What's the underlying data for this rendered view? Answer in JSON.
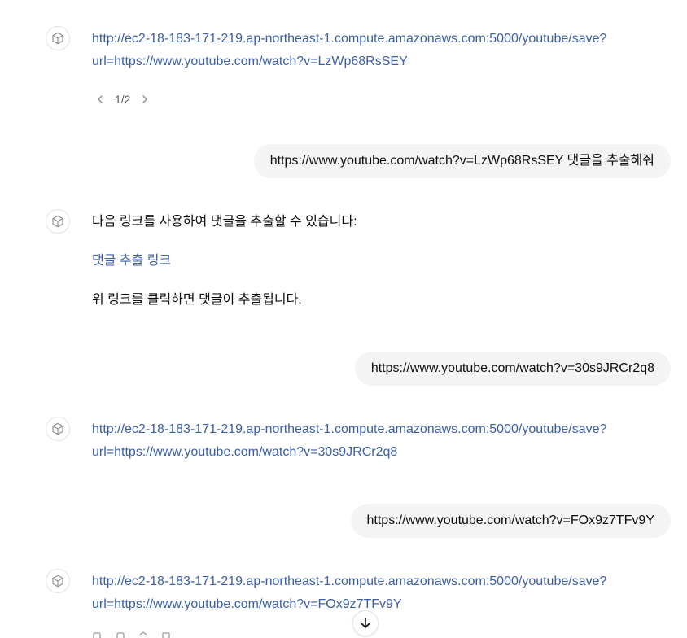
{
  "messages": [
    {
      "role": "assistant",
      "link_line1": "http://ec2-18-183-171-219.ap-northeast-1.compute.amazonaws.com:5000/youtube/save?",
      "link_line2": "url=https://www.youtube.com/watch?v=LzWp68RsSEY",
      "pager": "1/2"
    },
    {
      "role": "user",
      "text": "https://www.youtube.com/watch?v=LzWp68RsSEY 댓글을 추출해줘"
    },
    {
      "role": "assistant",
      "intro": "다음 링크를 사용하여 댓글을 추출할 수 있습니다:",
      "link_text": "댓글 추출 링크",
      "outro": "위 링크를 클릭하면 댓글이 추출됩니다."
    },
    {
      "role": "user",
      "text": "https://www.youtube.com/watch?v=30s9JRCr2q8"
    },
    {
      "role": "assistant",
      "link_line1": "http://ec2-18-183-171-219.ap-northeast-1.compute.amazonaws.com:5000/youtube/save?",
      "link_line2": "url=https://www.youtube.com/watch?v=30s9JRCr2q8"
    },
    {
      "role": "user",
      "text": "https://www.youtube.com/watch?v=FOx9z7TFv9Y"
    },
    {
      "role": "assistant",
      "link_line1": "http://ec2-18-183-171-219.ap-northeast-1.compute.amazonaws.com:5000/youtube/save?",
      "link_line2": "url=https://www.youtube.com/watch?v=FOx9z7TFv9Y"
    }
  ],
  "icons": {
    "avatar": "gpt-cube-icon",
    "prev": "chevron-left-icon",
    "next": "chevron-right-icon",
    "scroll": "arrow-down-icon"
  },
  "colors": {
    "link": "#3b5fa6",
    "bubble_bg": "#f4f4f4",
    "text": "#0d0d0d"
  }
}
